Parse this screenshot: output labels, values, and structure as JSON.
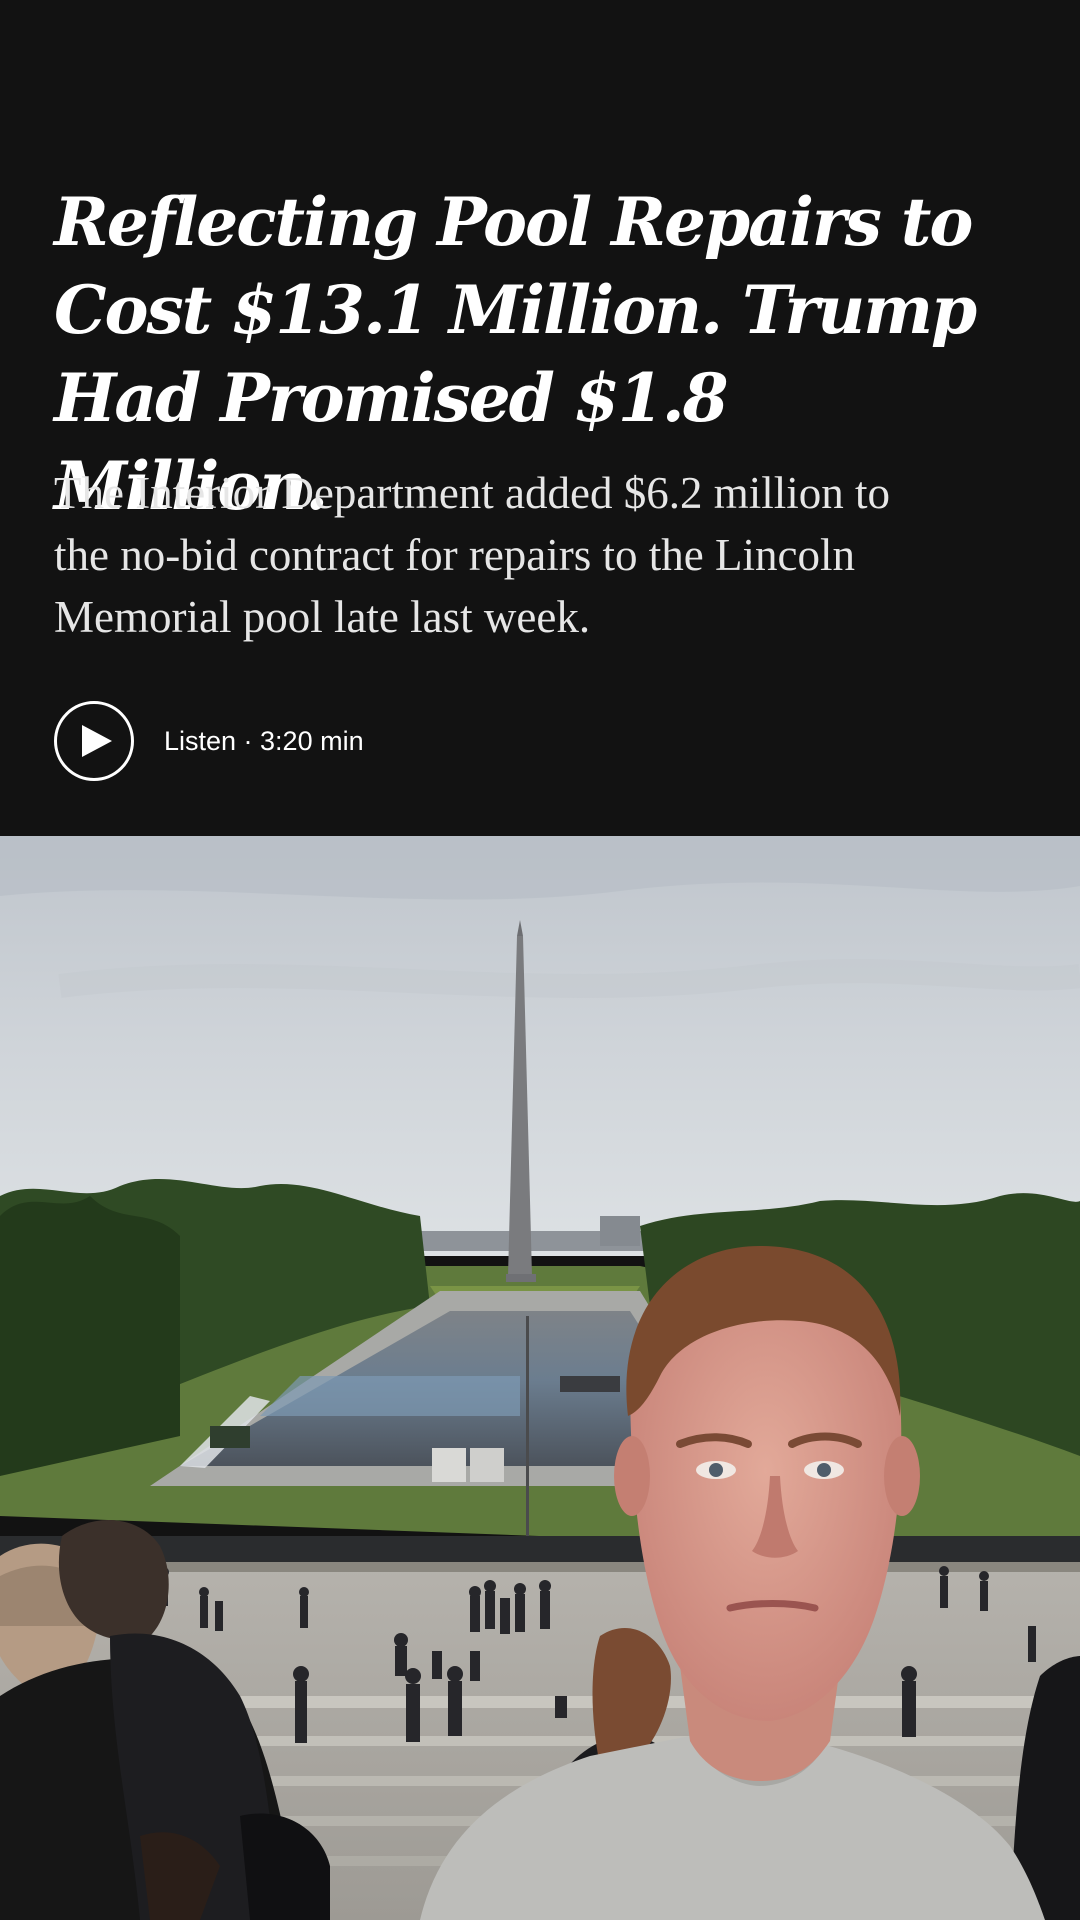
{
  "article": {
    "headline_lines": [
      "Reflecting Pool Repairs to",
      "Cost $13.1 Million. Trump",
      "Had Promised $1.8 Million."
    ],
    "summary_lines": [
      "The Interior Department added $6.2 million to",
      "the no-bid contract for repairs to the Lincoln",
      "Memorial pool late last week."
    ],
    "listen_label": "Listen · 3:20 min"
  },
  "icons": {
    "play": "play-icon"
  },
  "colors": {
    "background": "#121212",
    "text": "#ffffff",
    "summary_text": "#e6e6e6"
  }
}
